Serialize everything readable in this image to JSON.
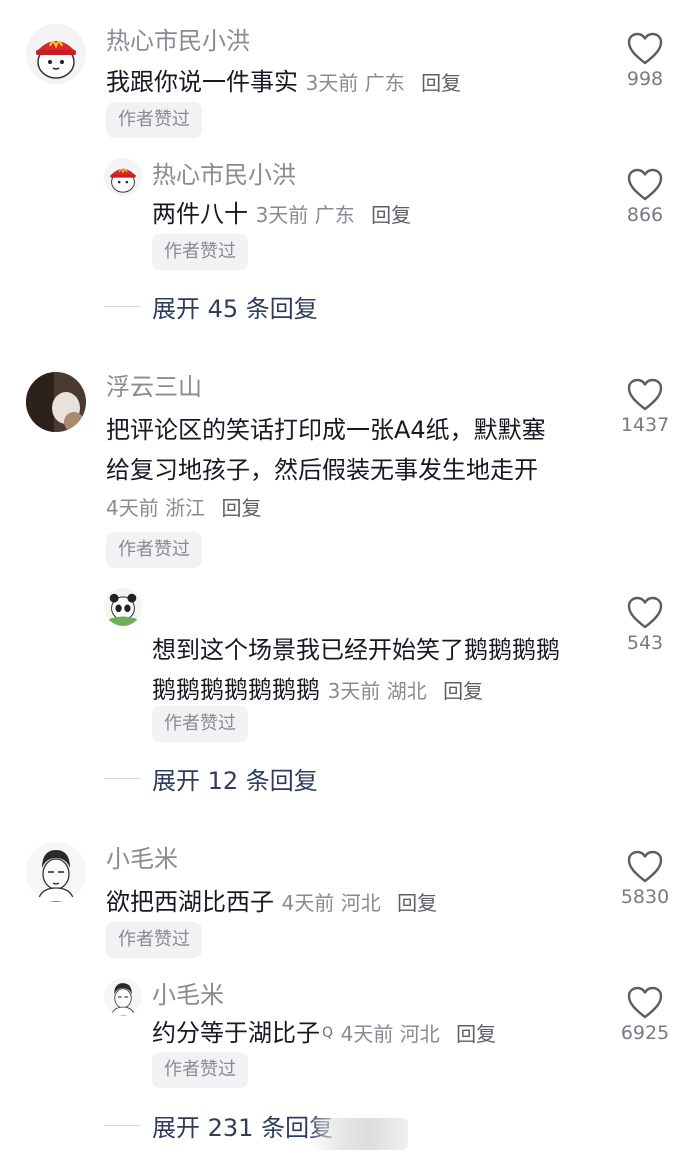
{
  "comments": [
    {
      "name": "热心市民小洪",
      "text": "我跟你说一件事实",
      "time": "3天前",
      "location": "广东",
      "reply_label": "回复",
      "chip": "作者赞过",
      "likes": "998",
      "reply": {
        "name": "热心市民小洪",
        "text": "两件八十",
        "time": "3天前",
        "location": "广东",
        "reply_label": "回复",
        "chip": "作者赞过",
        "likes": "866"
      },
      "expand": "展开 45 条回复"
    },
    {
      "name": "浮云三山",
      "text_line1": "把评论区的笑话打印成一张A4纸，默默塞",
      "text_line2": "给复习地孩子，然后假装无事发生地走开",
      "time": "4天前",
      "location": "浙江",
      "reply_label": "回复",
      "chip": "作者赞过",
      "likes": "1437",
      "reply": {
        "text_line1": "想到这个场景我已经开始笑了鹅鹅鹅鹅",
        "text_line2": "鹅鹅鹅鹅鹅鹅鹅",
        "time": "3天前",
        "location": "湖北",
        "reply_label": "回复",
        "chip": "作者赞过",
        "likes": "543"
      },
      "expand": "展开 12 条回复"
    },
    {
      "name": "小毛米",
      "text": "欲把西湖比西子",
      "time": "4天前",
      "location": "河北",
      "reply_label": "回复",
      "chip": "作者赞过",
      "likes": "5830",
      "reply": {
        "name": "小毛米",
        "text": "约分等于湖比子",
        "text_mark": "Q",
        "time": "4天前",
        "location": "河北",
        "reply_label": "回复",
        "chip": "作者赞过",
        "likes": "6925"
      },
      "expand": "展开 231 条回复"
    }
  ],
  "icons": {
    "like": "heart-outline-icon"
  },
  "colors": {
    "name": "#8a8b91",
    "text": "#161823",
    "expand": "#2f3c5a",
    "chip_bg": "#f2f2f4"
  }
}
